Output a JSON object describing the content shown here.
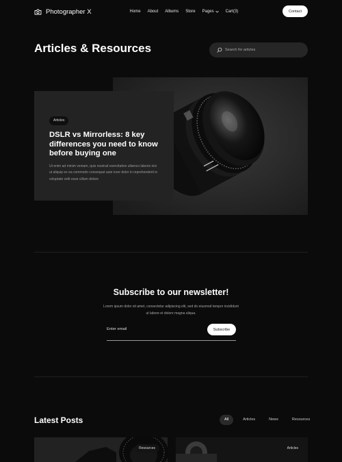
{
  "brand": {
    "name": "Photographer X",
    "icon": "camera-icon"
  },
  "nav": {
    "items": [
      "Home",
      "About",
      "Albums",
      "Store"
    ],
    "pages_label": "Pages",
    "cart_label": "Cart(3)"
  },
  "contact_label": "Contact",
  "page_title": "Articles & Resources",
  "search": {
    "placeholder": "Search for articles",
    "icon": "search-icon"
  },
  "hero": {
    "tag": "Articles",
    "title": "DSLR vs Mirrorless: 8 key differences you need to know before buying one",
    "text": "Ut enim ad minim veniam, quis nostrud exercitation ullamco laboris nisi ut aliquip ex ea commodo consequat aute irure dolor in reprehenderit in voluptate velit esse cillum dolore"
  },
  "newsletter": {
    "title": "Subscribe to our newsletter!",
    "text": "Lorem ipsum dolor sit amet, consectetur adipiscing elit, sed do eiusmod tempor incididunt ut labore et dolore magna aliqua.",
    "email_placeholder": "Enter email",
    "button_label": "Subscribe"
  },
  "latest": {
    "title": "Latest Posts",
    "filters": [
      "All",
      "Articles",
      "News",
      "Resources"
    ],
    "active_filter": "All",
    "posts": [
      {
        "tag": "Resources"
      },
      {
        "tag": "Articles"
      }
    ]
  },
  "colors": {
    "background": "#0b0b0b",
    "card": "#232323",
    "accent": "#ffffff"
  }
}
